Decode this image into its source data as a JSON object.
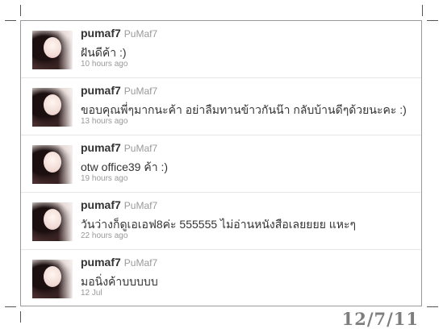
{
  "tweets": [
    {
      "user": "pumaf7",
      "screen_name": "PuMaf7",
      "text": "ฝันดีค้า :)",
      "time": "10 hours ago"
    },
    {
      "user": "pumaf7",
      "screen_name": "PuMaf7",
      "text": "ขอบคุณพี่ๆมากนะค้า อย่าลืมทานข้าวกันน๊า กลับบ้านดีๆด้วยนะคะ :)",
      "time": "13 hours ago"
    },
    {
      "user": "pumaf7",
      "screen_name": "PuMaf7",
      "text": "otw office39 ค้า :)",
      "time": "19 hours ago"
    },
    {
      "user": "pumaf7",
      "screen_name": "PuMaf7",
      "text": "วันว่างก็ดูเอเอฟ8ค่ะ 555555 ไม่อ่านหนังสือเลยยยย แหะๆ",
      "time": "22 hours ago"
    },
    {
      "user": "pumaf7",
      "screen_name": "PuMaf7",
      "text": "มอนิ่งค้าบบบบบ",
      "time": "12 Jul"
    }
  ],
  "date_stamp": "12/7/11"
}
